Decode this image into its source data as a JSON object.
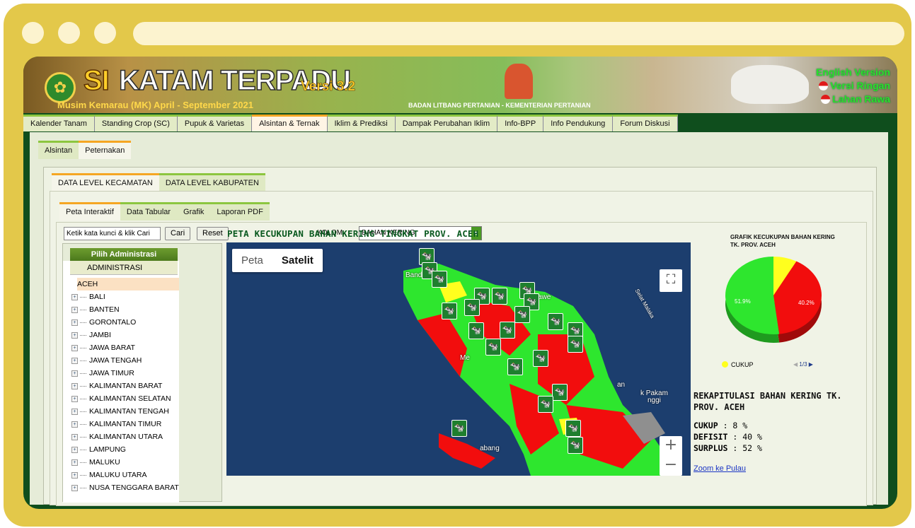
{
  "header": {
    "logo_glyph": "✿",
    "title_si": "SI",
    "title_main": "KATAM TERPADU",
    "version": "Versi 3.2",
    "season": "Musim Kemarau (MK) April - September 2021",
    "agency": "BADAN LITBANG PERTANIAN - KEMENTERIAN PERTANIAN",
    "lang_english": "English Version",
    "lang_ringan": "Versi Ringan",
    "lang_rawa": "Lahan Rawa"
  },
  "nav": {
    "items": [
      "Kalender Tanam",
      "Standing Crop (SC)",
      "Pupuk & Varietas",
      "Alsintan & Ternak",
      "Iklim & Prediksi",
      "Dampak Perubahan Iklim",
      "Info-BPP",
      "Info Pendukung",
      "Forum Diskusi"
    ]
  },
  "subtabs": [
    "Alsintan",
    "Peternakan"
  ],
  "level_tabs": [
    "DATA LEVEL KECAMATAN",
    "DATA LEVEL KABUPATEN"
  ],
  "view_tabs": [
    "Peta Interaktif",
    "Data Tabular",
    "Grafik",
    "Laporan PDF"
  ],
  "toolbar": {
    "search_value": "Ketik kata kunci & klik Cari",
    "cari": "Cari",
    "reset": "Reset",
    "kolom_label": "KOLOM :",
    "kolom_value": "BAHAN KERING"
  },
  "admin": {
    "title": "Pilih Administrasi",
    "header": "ADMINISTRASI",
    "items": [
      "ACEH",
      "BALI",
      "BANTEN",
      "GORONTALO",
      "JAMBI",
      "JAWA BARAT",
      "JAWA TENGAH",
      "JAWA TIMUR",
      "KALIMANTAN BARAT",
      "KALIMANTAN SELATAN",
      "KALIMANTAN TENGAH",
      "KALIMANTAN TIMUR",
      "KALIMANTAN UTARA",
      "LAMPUNG",
      "MALUKU",
      "MALUKU UTARA",
      "NUSA TENGGARA BARAT"
    ]
  },
  "map": {
    "title": "PETA KECUKUPAN BAHAN KERING TINGKAT PROV. ACEH",
    "type_peta": "Peta",
    "type_satelit": "Satelit",
    "zoom_in": "+",
    "zoom_out": "−",
    "fullscreen": "⛶",
    "labels": [
      "Banda",
      "awe",
      "Selat Malaka",
      "Me",
      "an",
      "k Pakam",
      "nggi",
      "abang"
    ],
    "colors": {
      "surplus": "#2ee62e",
      "defisit": "#f20d0d",
      "cukup": "#ffff1e",
      "sea": "#1c3e6e"
    }
  },
  "chart": {
    "title": "GRAFIK KECUKUPAN BAHAN KERING TK. PROV. ACEH",
    "legend_label": "CUKUP",
    "pager": "1/3",
    "label_green": "51.9%",
    "label_red": "40.2%"
  },
  "chart_data": {
    "type": "pie",
    "title": "GRAFIK KECUKUPAN BAHAN KERING TK. PROV. ACEH",
    "labels": [
      "CUKUP",
      "DEFISIT",
      "SURPLUS"
    ],
    "values": [
      7.9,
      40.2,
      51.9
    ],
    "colors": [
      "#ffff1e",
      "#f20d0d",
      "#2ee62e"
    ]
  },
  "rekap": {
    "title": "REKAPITULASI BAHAN KERING TK. PROV. ACEH",
    "cukup_label": "CUKUP",
    "cukup_value": ": 8 %",
    "defisit_label": "DEFISIT",
    "defisit_value": ": 40 %",
    "surplus_label": "SURPLUS",
    "surplus_value": ": 52 %",
    "zoom_link": "Zoom ke Pulau"
  }
}
